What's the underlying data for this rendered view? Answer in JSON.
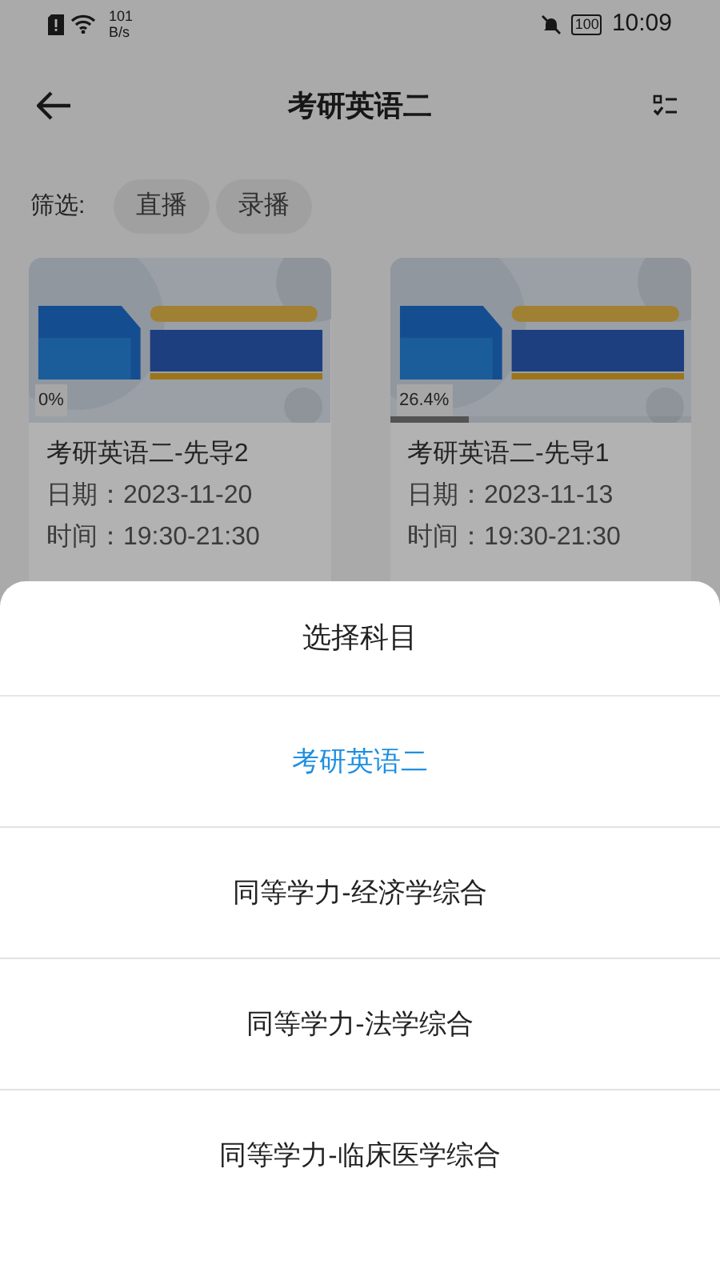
{
  "status_bar": {
    "speed_value": "101",
    "speed_unit": "B/s",
    "battery": "100",
    "time": "10:09"
  },
  "header": {
    "title": "考研英语二"
  },
  "filter": {
    "label": "筛选:",
    "chips": [
      {
        "label": "直播"
      },
      {
        "label": "录播"
      }
    ]
  },
  "courses": [
    {
      "progress_text": "0%",
      "title": "考研英语二-先导2",
      "date": "日期：2023-11-20",
      "time": "时间：19:30-21:30"
    },
    {
      "progress_text": "26.4%",
      "level": 0.264,
      "title": "考研英语二-先导1",
      "date": "日期：2023-11-13",
      "time": "时间：19:30-21:30"
    }
  ],
  "sheet": {
    "title": "选择科目",
    "options": [
      {
        "label": "考研英语二",
        "selected": true
      },
      {
        "label": "同等学力-经济学综合",
        "selected": false
      },
      {
        "label": "同等学力-法学综合",
        "selected": false
      },
      {
        "label": "同等学力-临床医学综合",
        "selected": false
      }
    ]
  }
}
